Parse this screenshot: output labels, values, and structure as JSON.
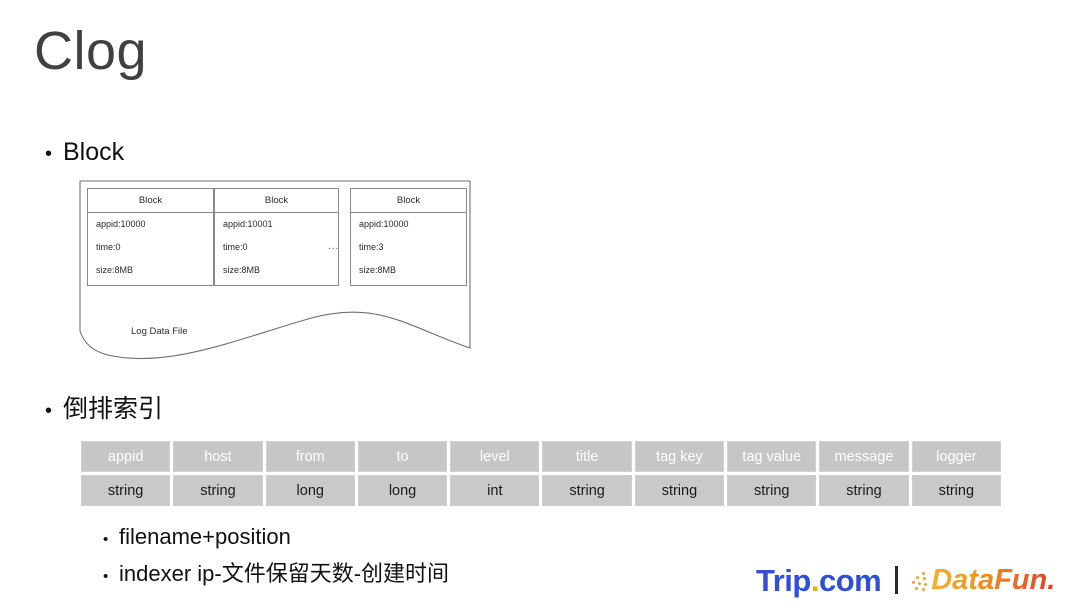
{
  "slide": {
    "title": "Clog"
  },
  "bullets": [
    {
      "marker": "•",
      "label": "Block"
    },
    {
      "marker": "•",
      "label": "倒排索引"
    }
  ],
  "diagram": {
    "file_label": "Log Data File",
    "ellipsis": "...",
    "blocks": [
      {
        "header": "Block",
        "fields": [
          "appid:10000",
          "time:0",
          "size:8MB"
        ]
      },
      {
        "header": "Block",
        "fields": [
          "appid:10001",
          "time:0",
          "size:8MB"
        ]
      },
      {
        "header": "Block",
        "fields": [
          "appid:10000",
          "time:3",
          "size:8MB"
        ]
      }
    ]
  },
  "schema_table": {
    "columns": [
      "appid",
      "host",
      "from",
      "to",
      "level",
      "title",
      "tag key",
      "tag value",
      "message",
      "logger"
    ],
    "types": [
      "string",
      "string",
      "long",
      "long",
      "int",
      "string",
      "string",
      "string",
      "string",
      "string"
    ]
  },
  "sub_bullets": [
    {
      "marker": "•",
      "label": "filename+position"
    },
    {
      "marker": "•",
      "label": "indexer ip-文件保留天数-创建时间"
    }
  ],
  "footer": {
    "trip_logo_main": "Trip",
    "trip_logo_dot": ".",
    "trip_logo_tld": "com",
    "datafun_logo": "DataFun."
  },
  "colors": {
    "title": "#404040",
    "table_header_bg": "#c6c6c6",
    "table_type_bg": "#c9c9c9",
    "trip_blue": "#2f4fd8",
    "trip_orange": "#f5a623",
    "datafun_orange": "#f0a430"
  }
}
